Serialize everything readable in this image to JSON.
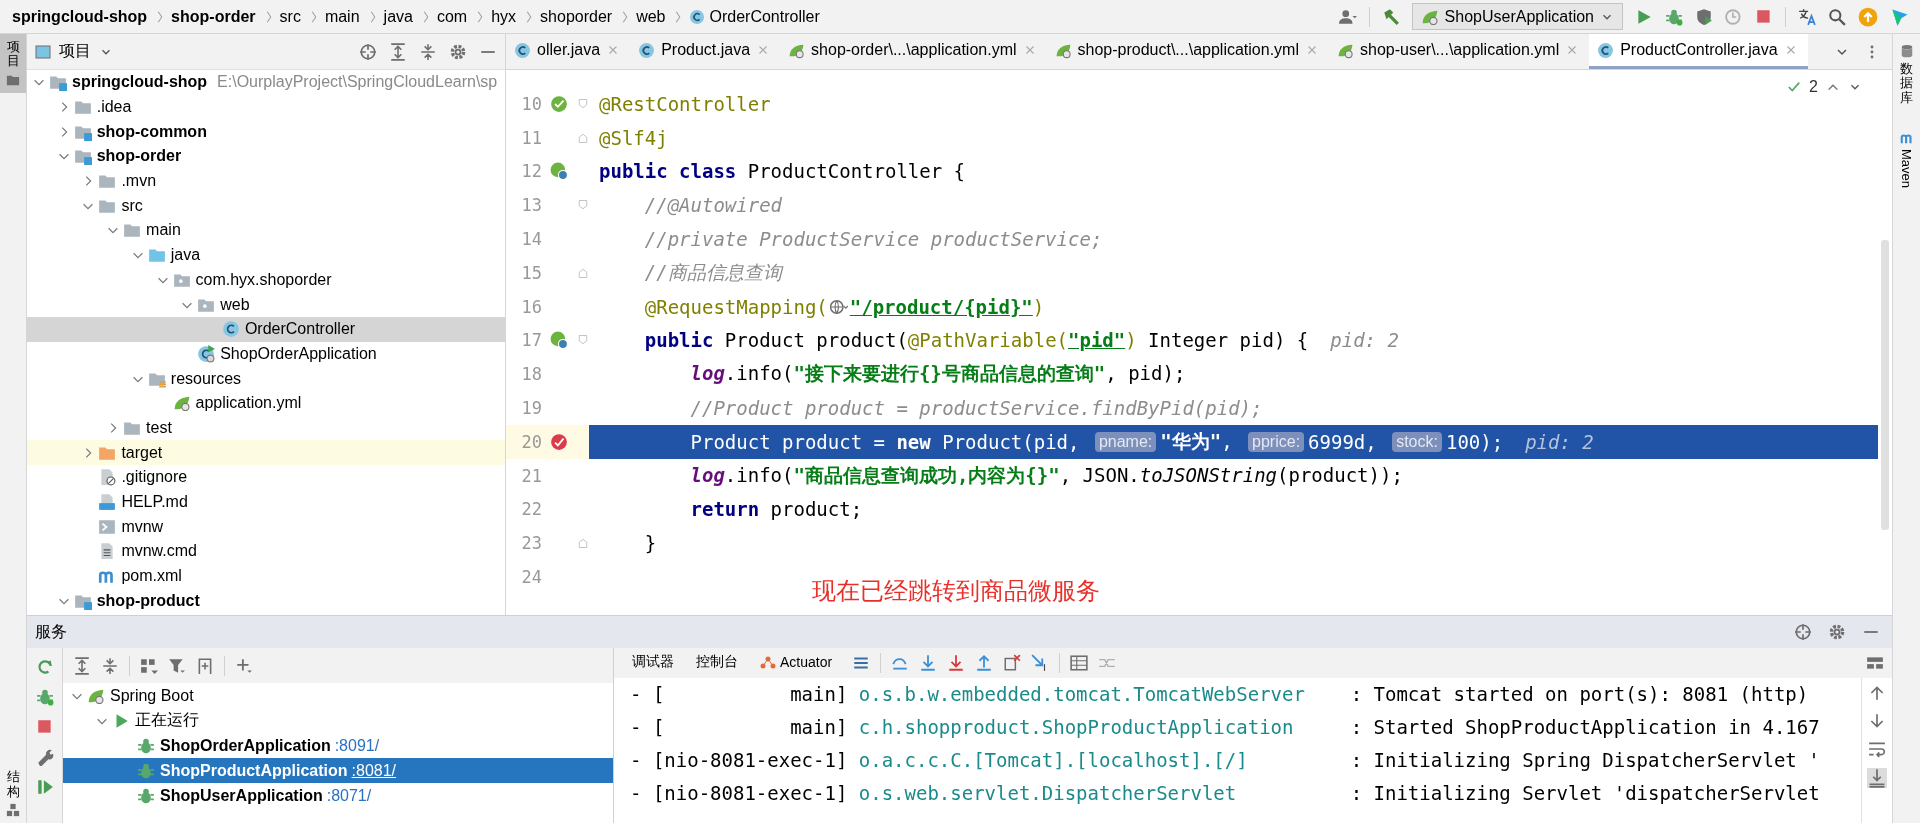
{
  "breadcrumbs": [
    {
      "text": "springcloud-shop",
      "kind": "module"
    },
    {
      "text": "shop-order",
      "kind": "module"
    },
    {
      "text": "src",
      "kind": "folder"
    },
    {
      "text": "main",
      "kind": "folder"
    },
    {
      "text": "java",
      "kind": "folder"
    },
    {
      "text": "com",
      "kind": "folder"
    },
    {
      "text": "hyx",
      "kind": "folder"
    },
    {
      "text": "shoporder",
      "kind": "folder"
    },
    {
      "text": "web",
      "kind": "folder"
    },
    {
      "text": "OrderController",
      "kind": "class"
    }
  ],
  "run_config": "ShopUserApplication",
  "left_stripe": {
    "top": [
      {
        "label": "项目",
        "selected": true
      }
    ],
    "bottom": [
      {
        "label": "结构",
        "selected": false
      }
    ]
  },
  "right_stripe": [
    {
      "label": "数据库",
      "kind": "database"
    },
    {
      "label": "Maven",
      "kind": "maven"
    }
  ],
  "project": {
    "title": "项目",
    "tree": [
      {
        "name": "springcloud-shop",
        "path": "E:\\OurplayProject\\SpringCloudLearn\\sp",
        "kind": "module",
        "expanded": true,
        "selected": false,
        "children": [
          {
            "name": ".idea",
            "kind": "folder",
            "expanded": false,
            "selected": false
          },
          {
            "name": "shop-common",
            "kind": "module",
            "expanded": false,
            "selected": false
          },
          {
            "name": "shop-order",
            "kind": "module",
            "expanded": true,
            "selected": false,
            "children": [
              {
                "name": ".mvn",
                "kind": "folder",
                "expanded": false,
                "selected": false
              },
              {
                "name": "src",
                "kind": "folder",
                "expanded": true,
                "selected": false,
                "children": [
                  {
                    "name": "main",
                    "kind": "folder",
                    "expanded": true,
                    "selected": false,
                    "children": [
                      {
                        "name": "java",
                        "kind": "source",
                        "expanded": true,
                        "selected": false,
                        "children": [
                          {
                            "name": "com.hyx.shoporder",
                            "kind": "package",
                            "expanded": true,
                            "selected": false,
                            "children": [
                              {
                                "name": "web",
                                "kind": "package",
                                "expanded": true,
                                "selected": false,
                                "children": [
                                  {
                                    "name": "OrderController",
                                    "kind": "class",
                                    "selected": true
                                  }
                                ]
                              },
                              {
                                "name": "ShopOrderApplication",
                                "kind": "spring-class",
                                "selected": false
                              }
                            ]
                          }
                        ]
                      },
                      {
                        "name": "resources",
                        "kind": "resources",
                        "expanded": true,
                        "selected": false,
                        "children": [
                          {
                            "name": "application.yml",
                            "kind": "yml",
                            "selected": false
                          }
                        ]
                      }
                    ]
                  },
                  {
                    "name": "test",
                    "kind": "folder",
                    "expanded": false,
                    "selected": false
                  }
                ]
              },
              {
                "name": "target",
                "kind": "excluded",
                "expanded": false,
                "selected": false
              },
              {
                "name": ".gitignore",
                "kind": "gitignore",
                "selected": false
              },
              {
                "name": "HELP.md",
                "kind": "markdown",
                "selected": false
              },
              {
                "name": "mvnw",
                "kind": "script",
                "selected": false
              },
              {
                "name": "mvnw.cmd",
                "kind": "text-file",
                "selected": false
              },
              {
                "name": "pom.xml",
                "kind": "maven",
                "selected": false
              }
            ]
          },
          {
            "name": "shop-product",
            "kind": "module",
            "expanded": true,
            "selected": false
          }
        ]
      }
    ]
  },
  "editor": {
    "tabs": [
      {
        "label": "oller.java",
        "kind": "class",
        "selected": false
      },
      {
        "label": "Product.java",
        "kind": "class",
        "selected": false
      },
      {
        "label": "shop-order\\...\\application.yml",
        "kind": "yml",
        "selected": false
      },
      {
        "label": "shop-product\\...\\application.yml",
        "kind": "yml",
        "selected": false
      },
      {
        "label": "shop-user\\...\\application.yml",
        "kind": "yml",
        "selected": false
      },
      {
        "label": "ProductController.java",
        "kind": "class",
        "selected": true
      }
    ],
    "inspection_count": "2",
    "lines": [
      {
        "number": "10",
        "gutter": {
          "kind": "bean"
        },
        "fold": {
          "kind": "start"
        },
        "current": false,
        "tokens": [
          {
            "kind": "ann",
            "text": "@RestController"
          }
        ]
      },
      {
        "number": "11",
        "fold": {
          "kind": "end"
        },
        "current": false,
        "tokens": [
          {
            "kind": "ann",
            "text": "@Slf4j"
          }
        ]
      },
      {
        "number": "12",
        "gutter": {
          "kind": "bean-web"
        },
        "current": false,
        "tokens": [
          {
            "kind": "kw",
            "text": "public class"
          },
          {
            "kind": "plain",
            "text": " ProductController {"
          }
        ]
      },
      {
        "number": "13",
        "fold": {
          "kind": "start"
        },
        "current": false,
        "tokens": [
          {
            "kind": "cmt",
            "text": "    //@Autowired"
          }
        ]
      },
      {
        "number": "14",
        "current": false,
        "tokens": [
          {
            "kind": "cmt",
            "text": "    //private ProductService productService;"
          }
        ]
      },
      {
        "number": "15",
        "fold": {
          "kind": "end"
        },
        "current": false,
        "tokens": [
          {
            "kind": "cmt",
            "text": "    //商品信息查询"
          }
        ]
      },
      {
        "number": "16",
        "current": false,
        "tokens": [
          {
            "kind": "ann",
            "text": "    @RequestMapping("
          },
          {
            "kind": "globe"
          },
          {
            "kind": "url",
            "text": "\"/product/{pid}\""
          },
          {
            "kind": "ann",
            "text": ")"
          }
        ]
      },
      {
        "number": "17",
        "gutter": {
          "kind": "bean-web"
        },
        "fold": {
          "kind": "start"
        },
        "current": false,
        "tokens": [
          {
            "kind": "kw",
            "text": "    public"
          },
          {
            "kind": "plain",
            "text": " Product product("
          },
          {
            "kind": "ann",
            "text": "@PathVariable("
          },
          {
            "kind": "url",
            "text": "\"pid\""
          },
          {
            "kind": "ann",
            "text": ")"
          },
          {
            "kind": "plain",
            "text": " Integer pid) {"
          },
          {
            "kind": "debug",
            "text": "pid: 2"
          }
        ]
      },
      {
        "number": "18",
        "current": false,
        "tokens": [
          {
            "kind": "field",
            "text": "        log"
          },
          {
            "kind": "plain",
            "text": ".info("
          },
          {
            "kind": "str",
            "text": "\"接下来要进行{}号商品信息的查询\""
          },
          {
            "kind": "plain",
            "text": ", pid);"
          }
        ]
      },
      {
        "number": "19",
        "current": false,
        "tokens": [
          {
            "kind": "cmt",
            "text": "        //Product product = productService.findByPid(pid);"
          }
        ]
      },
      {
        "number": "20",
        "gutter": {
          "kind": "breakpoint"
        },
        "current": true,
        "tokens": [
          {
            "kind": "plain",
            "text": "        Product product = "
          },
          {
            "kind": "kw",
            "text": "new"
          },
          {
            "kind": "plain",
            "text": " Product(pid, "
          },
          {
            "kind": "hint",
            "text": "pname:"
          },
          {
            "kind": "str",
            "text": "\"华为\""
          },
          {
            "kind": "plain",
            "text": ", "
          },
          {
            "kind": "hint",
            "text": "pprice:"
          },
          {
            "kind": "plain",
            "text": "6999d, "
          },
          {
            "kind": "hint",
            "text": "stock:"
          },
          {
            "kind": "plain",
            "text": "100);"
          },
          {
            "kind": "debug",
            "text": "pid: 2"
          }
        ]
      },
      {
        "number": "21",
        "current": false,
        "tokens": [
          {
            "kind": "field",
            "text": "        log"
          },
          {
            "kind": "plain",
            "text": ".info("
          },
          {
            "kind": "str",
            "text": "\"商品信息查询成功,内容为{}\""
          },
          {
            "kind": "plain",
            "text": ", JSON."
          },
          {
            "kind": "method",
            "text": "toJSONString"
          },
          {
            "kind": "plain",
            "text": "(product));"
          }
        ]
      },
      {
        "number": "22",
        "current": false,
        "tokens": [
          {
            "kind": "kw",
            "text": "        return"
          },
          {
            "kind": "plain",
            "text": " product;"
          }
        ]
      },
      {
        "number": "23",
        "fold": {
          "kind": "end"
        },
        "current": false,
        "tokens": [
          {
            "kind": "plain",
            "text": "    }"
          }
        ]
      },
      {
        "number": "24",
        "current": false
      }
    ],
    "annotation": "现在已经跳转到商品微服务"
  },
  "services": {
    "title": "服务",
    "tree": [
      {
        "name": "Spring Boot",
        "kind": "spring",
        "expanded": true,
        "selected": false,
        "children": [
          {
            "name": "正在运行",
            "kind": "running",
            "expanded": true,
            "selected": false,
            "children": [
              {
                "name": "ShopOrderApplication",
                "port": ":8091/",
                "kind": "app",
                "selected": false
              },
              {
                "name": "ShopProductApplication",
                "port": ":8081/",
                "kind": "app",
                "selected": true
              },
              {
                "name": "ShopUserApplication",
                "port": ":8071/",
                "kind": "app",
                "selected": false
              }
            ]
          }
        ]
      }
    ]
  },
  "console": {
    "tabs": [
      {
        "label": "调试器",
        "kind": "text",
        "selected": false
      },
      {
        "label": "控制台",
        "kind": "text",
        "selected": false
      },
      {
        "label": "Actuator",
        "kind": "actuator",
        "selected": false
      }
    ],
    "lines": [
      {
        "thread": "- [           main]",
        "logger": "o.s.b.w.embedded.tomcat.TomcatWebServer",
        "message": ": Tomcat started on port(s): 8081 (http)"
      },
      {
        "thread": "- [           main]",
        "logger": "c.h.shopproduct.ShopProductApplication",
        "message": ": Started ShopProductApplication in 4.167"
      },
      {
        "thread": "- [nio-8081-exec-1]",
        "logger": "o.a.c.c.C.[Tomcat].[localhost].[/]",
        "message": ": Initializing Spring DispatcherServlet '"
      },
      {
        "thread": "- [nio-8081-exec-1]",
        "logger": "o.s.web.servlet.DispatcherServlet",
        "message": ": Initializing Servlet 'dispatcherServlet"
      }
    ]
  }
}
